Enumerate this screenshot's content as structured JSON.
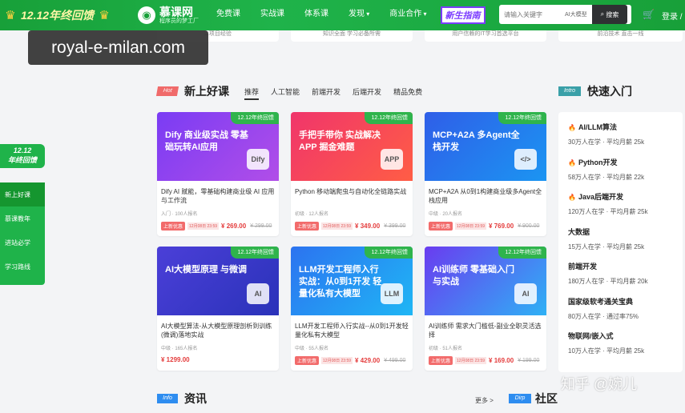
{
  "header": {
    "promo": "12.12年终回馈",
    "logo_name": "慕课网",
    "logo_slogan": "程序员的梦工厂",
    "nav": [
      {
        "label": "免费课",
        "drop": false
      },
      {
        "label": "实战课",
        "drop": false
      },
      {
        "label": "体系课",
        "drop": false
      },
      {
        "label": "发现",
        "drop": true
      },
      {
        "label": "商业合作",
        "drop": true
      }
    ],
    "newbie": "新生指南",
    "search_placeholder": "请输入关键字",
    "search_tag": "AI大模型",
    "search_button": "搜索",
    "login": "登录 /"
  },
  "overlay_label": "royal-e-milan.com",
  "top_strip": [
    "...项目经验",
    "知识全面 学习必备所需",
    "用户信赖的IT学习首选平台",
    "前沿技术 直击一线"
  ],
  "sidebar": {
    "badge_top": "12.12",
    "badge": "年终回馈",
    "items": [
      "新上好课",
      "慕课教年",
      "进站必学",
      "学习路线"
    ]
  },
  "section": {
    "tag": "Hot",
    "title": "新上好课",
    "tabs": [
      "推荐",
      "人工智能",
      "前端开发",
      "后端开发",
      "精品免费"
    ]
  },
  "ribbon": "12.12年终回馈",
  "courses": [
    {
      "thumb": "Dify 商业级实战 零基础玩转AI应用",
      "icon": "Dify",
      "title": "Dify AI 赋能，零基础构建商业级 AI 应用与工作流",
      "meta": "入门 · 100人报名",
      "tag": "上新优惠",
      "date": "12月08日 23:59",
      "price": "¥ 269.00",
      "old": "¥ 299.00"
    },
    {
      "thumb": "手把手带你 实战解决 APP 掘金难题",
      "icon": "APP",
      "title": "Python 移动端爬虫与自动化全链路实战",
      "meta": "初级 · 12人报名",
      "tag": "上新优惠",
      "date": "12月08日 23:59",
      "price": "¥ 349.00",
      "old": "¥ 399.00"
    },
    {
      "thumb": "MCP+A2A 多Agent全栈开发",
      "icon": "</>",
      "title": "MCP+A2A 从0到1构建商业级多Agent全栈应用",
      "meta": "中级 · 20人报名",
      "tag": "上新优惠",
      "date": "12月08日 23:59",
      "price": "¥ 769.00",
      "old": "¥ 900.00"
    },
    {
      "thumb": "AI大模型原理 与微调",
      "icon": "AI",
      "title": "AI大模型算法-从大模型原理剖析到训练(微调)落地实战",
      "meta": "中级 · 165人报名",
      "tag": "",
      "date": "",
      "price": "¥ 1299.00",
      "old": ""
    },
    {
      "thumb": "LLM开发工程师入行 实战：从0到1开发 轻量化私有大模型",
      "icon": "LLM",
      "title": "LLM开发工程师入行实战--从0到1开发轻量化私有大模型",
      "meta": "中级 · 55人报名",
      "tag": "上新优惠",
      "date": "12月08日 23:59",
      "price": "¥ 429.00",
      "old": "¥ 499.00"
    },
    {
      "thumb": "AI训练师 零基础入门与实战",
      "icon": "AI",
      "title": "AI训练师 需求大门槛低-副业全职灵活选择",
      "meta": "初级 · 51人报名",
      "tag": "上新优惠",
      "date": "12月08日 23:59",
      "price": "¥ 169.00",
      "old": "¥ 199.00"
    }
  ],
  "quick": {
    "tag": "Intro",
    "title": "快速入门",
    "items": [
      {
        "name": "AI/LLM算法",
        "hot": true,
        "stats": "30万人在学 · 平均月薪 25k"
      },
      {
        "name": "Python开发",
        "hot": true,
        "stats": "58万人在学 · 平均月薪 22k"
      },
      {
        "name": "Java后端开发",
        "hot": true,
        "stats": "120万人在学 · 平均月薪 25k"
      },
      {
        "name": "大数据",
        "hot": false,
        "stats": "15万人在学 · 平均月薪 25k"
      },
      {
        "name": "前端开发",
        "hot": false,
        "stats": "180万人在学 · 平均月薪 20k"
      },
      {
        "name": "国家级软考通关宝典",
        "hot": false,
        "stats": "80万人在学 · 通过率75%"
      },
      {
        "name": "物联网/嵌入式",
        "hot": false,
        "stats": "10万人在学 · 平均月薪 25k"
      }
    ]
  },
  "bottom": {
    "info_tag": "Info",
    "info_title": "资讯",
    "more": "更多 >",
    "dirp_tag": "Dirp",
    "comm_title": "社区"
  },
  "watermark": "知乎 @婉儿"
}
